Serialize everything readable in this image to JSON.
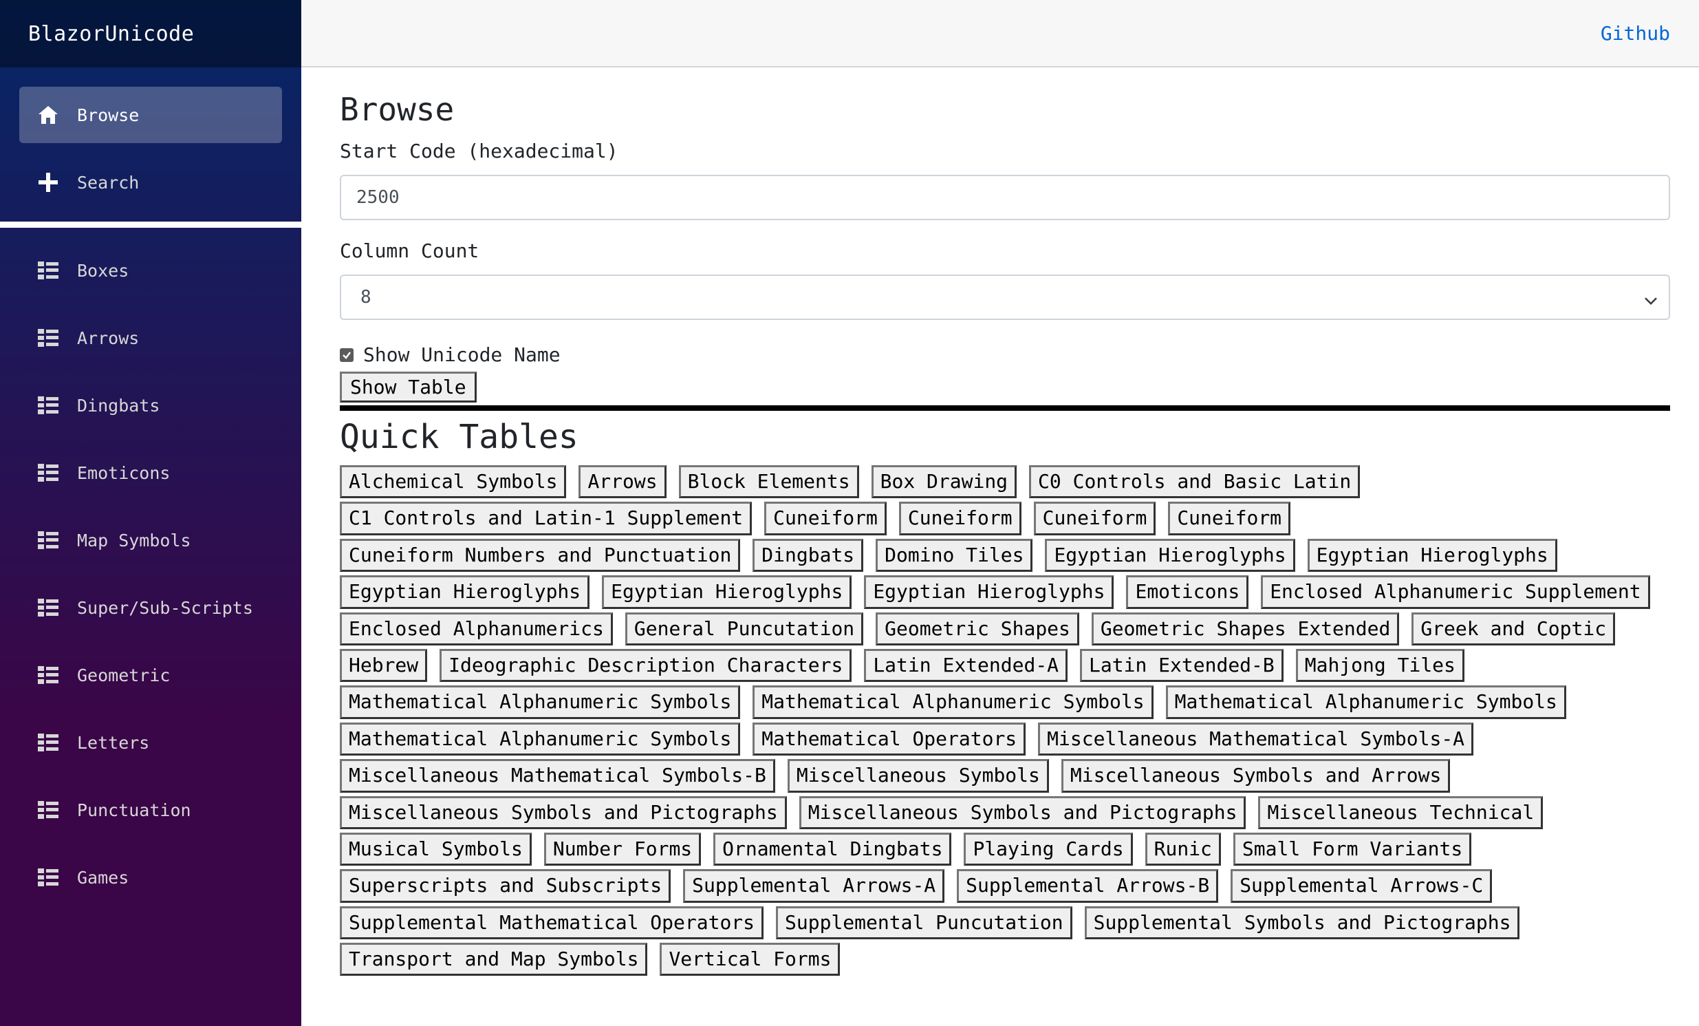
{
  "brand": "BlazorUnicode",
  "top_link": "Github",
  "nav_main": [
    {
      "label": "Browse",
      "icon": "home-icon"
    },
    {
      "label": "Search",
      "icon": "plus-icon"
    }
  ],
  "nav_tables": [
    {
      "label": "Boxes"
    },
    {
      "label": "Arrows"
    },
    {
      "label": "Dingbats"
    },
    {
      "label": "Emoticons"
    },
    {
      "label": "Map Symbols"
    },
    {
      "label": "Super/Sub-Scripts"
    },
    {
      "label": "Geometric"
    },
    {
      "label": "Letters"
    },
    {
      "label": "Punctuation"
    },
    {
      "label": "Games"
    }
  ],
  "page": {
    "title": "Browse",
    "start_code_label": "Start Code (hexadecimal)",
    "start_code_value": "2500",
    "column_count_label": "Column Count",
    "column_count_value": "8",
    "show_name_label": "Show Unicode Name",
    "show_name_checked": true,
    "show_table_button": "Show Table",
    "quick_tables_title": "Quick Tables"
  },
  "quick_tables": [
    "Alchemical Symbols",
    "Arrows",
    "Block Elements",
    "Box Drawing",
    "C0 Controls and Basic Latin",
    "C1 Controls and Latin-1 Supplement",
    "Cuneiform",
    "Cuneiform",
    "Cuneiform",
    "Cuneiform",
    "Cuneiform Numbers and Punctuation",
    "Dingbats",
    "Domino Tiles",
    "Egyptian Hieroglyphs",
    "Egyptian Hieroglyphs",
    "Egyptian Hieroglyphs",
    "Egyptian Hieroglyphs",
    "Egyptian Hieroglyphs",
    "Emoticons",
    "Enclosed Alphanumeric Supplement",
    "Enclosed Alphanumerics",
    "General Puncutation",
    "Geometric Shapes",
    "Geometric Shapes Extended",
    "Greek and Coptic",
    "Hebrew",
    "Ideographic Description Characters",
    "Latin Extended-A",
    "Latin Extended-B",
    "Mahjong Tiles",
    "Mathematical Alphanumeric Symbols",
    "Mathematical Alphanumeric Symbols",
    "Mathematical Alphanumeric Symbols",
    "Mathematical Alphanumeric Symbols",
    "Mathematical Operators",
    "Miscellaneous Mathematical Symbols-A",
    "Miscellaneous Mathematical Symbols-B",
    "Miscellaneous Symbols",
    "Miscellaneous Symbols and Arrows",
    "Miscellaneous Symbols and Pictographs",
    "Miscellaneous Symbols and Pictographs",
    "Miscellaneous Technical",
    "Musical Symbols",
    "Number Forms",
    "Ornamental Dingbats",
    "Playing Cards",
    "Runic",
    "Small Form Variants",
    "Superscripts and Subscripts",
    "Supplemental Arrows-A",
    "Supplemental Arrows-B",
    "Supplemental Arrows-C",
    "Supplemental Mathematical Operators",
    "Supplemental Puncutation",
    "Supplemental Symbols and Pictographs",
    "Transport and Map Symbols",
    "Vertical Forms"
  ]
}
